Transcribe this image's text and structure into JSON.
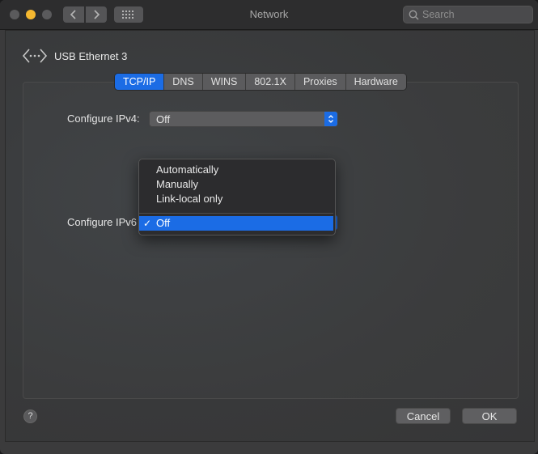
{
  "window": {
    "title": "Network"
  },
  "toolbar": {
    "search_placeholder": "Search"
  },
  "interface": {
    "name": "USB Ethernet 3"
  },
  "tabs": [
    {
      "label": "TCP/IP",
      "active": true
    },
    {
      "label": "DNS",
      "active": false
    },
    {
      "label": "WINS",
      "active": false
    },
    {
      "label": "802.1X",
      "active": false
    },
    {
      "label": "Proxies",
      "active": false
    },
    {
      "label": "Hardware",
      "active": false
    }
  ],
  "ipv4": {
    "label": "Configure IPv4:",
    "value": "Off"
  },
  "ipv6": {
    "label": "Configure IPv6",
    "options": [
      "Automatically",
      "Manually",
      "Link-local only"
    ],
    "selected": "Off",
    "check_mark": "✓"
  },
  "help": {
    "label": "?"
  },
  "buttons": {
    "cancel": "Cancel",
    "ok": "OK"
  },
  "colors": {
    "accent": "#1b6ce5",
    "window_bg": "#3b3b3c",
    "titlebar_bg": "#2d2d2e",
    "minimize": "#f5b830"
  }
}
